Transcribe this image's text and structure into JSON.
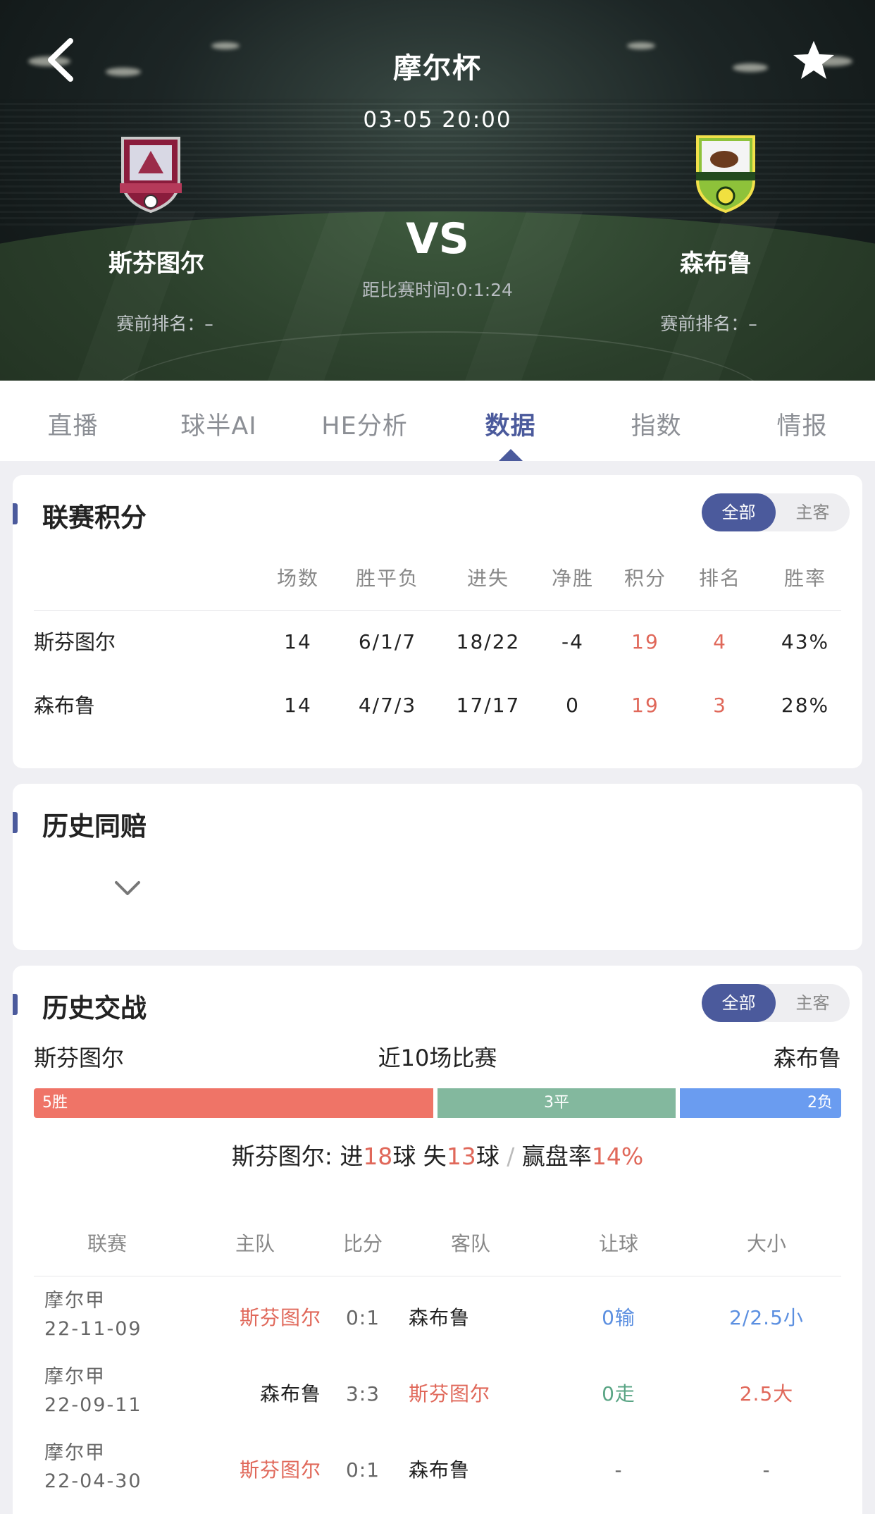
{
  "header": {
    "title": "摩尔杯",
    "datetime": "03-05 20:00",
    "vs": "VS",
    "countdown": "距比赛时间:0:1:24",
    "home": {
      "name": "斯芬图尔",
      "rank": "赛前排名：–"
    },
    "away": {
      "name": "森布鲁",
      "rank": "赛前排名：–"
    }
  },
  "tabs": [
    "直播",
    "球半AI",
    "HE分析",
    "数据",
    "指数",
    "情报"
  ],
  "active_tab": "数据",
  "standings": {
    "title": "联赛积分",
    "filter": [
      "全部",
      "主客"
    ],
    "columns": [
      "场数",
      "胜平负",
      "进失",
      "净胜",
      "积分",
      "排名",
      "胜率"
    ],
    "rows": [
      {
        "team": "斯芬图尔",
        "cells": [
          "14",
          "6/1/7",
          "18/22",
          "-4",
          "19",
          "4",
          "43%"
        ]
      },
      {
        "team": "森布鲁",
        "cells": [
          "14",
          "4/7/3",
          "17/17",
          "0",
          "19",
          "3",
          "28%"
        ]
      }
    ]
  },
  "same_odds": {
    "title": "历史同赔"
  },
  "h2h": {
    "title": "历史交战",
    "filter": [
      "全部",
      "主客"
    ],
    "home": "斯芬图尔",
    "label": "近10场比赛",
    "away": "森布鲁",
    "bar": {
      "win": "5胜",
      "draw": "3平",
      "loss": "2负",
      "win_n": 5,
      "draw_n": 3,
      "loss_n": 2
    },
    "summary": {
      "team": "斯芬图尔: ",
      "p1": "进",
      "goals_for": "18",
      "p2": "球 失",
      "goals_against": "13",
      "p3": "球",
      "sep": " / ",
      "p4": "赢盘率",
      "rate": "14%"
    },
    "columns": [
      "联赛",
      "主队",
      "比分",
      "客队",
      "让球",
      "大小"
    ],
    "matches": [
      {
        "league": "摩尔甲",
        "date": "22-11-09",
        "home": "斯芬图尔",
        "score": "0:1",
        "away": "森布鲁",
        "handicap": "0输",
        "ou": "2/2.5小"
      },
      {
        "league": "摩尔甲",
        "date": "22-09-11",
        "home": "森布鲁",
        "score": "3:3",
        "away": "斯芬图尔",
        "handicap": "0走",
        "ou": "2.5大"
      },
      {
        "league": "摩尔甲",
        "date": "22-04-30",
        "home": "斯芬图尔",
        "score": "0:1",
        "away": "森布鲁",
        "handicap": "-",
        "ou": "-"
      }
    ]
  },
  "colors": {
    "accent": "#4b5a9c",
    "win": "#ef7467",
    "draw": "#83b89e",
    "loss": "#6a9cf0"
  }
}
